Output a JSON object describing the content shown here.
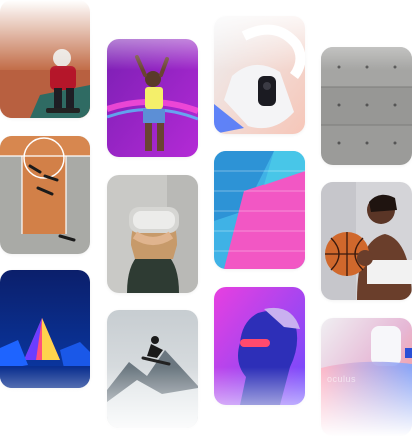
{
  "gallery": {
    "columns": [
      {
        "tiles": [
          {
            "subject": "skateboarder-on-orange-ground-photo"
          },
          {
            "subject": "aerial-basketball-court-players-photo"
          },
          {
            "subject": "neon-pyramid-landscape-photo"
          }
        ]
      },
      {
        "tiles": [
          {
            "subject": "dancer-neon-lights-photo"
          },
          {
            "subject": "vr-headset-user-photo"
          },
          {
            "subject": "snowboarder-mountain-jump-photo"
          }
        ]
      },
      {
        "tiles": [
          {
            "subject": "vr-controller-closeup-photo"
          },
          {
            "subject": "pink-blue-brick-wall-photo"
          },
          {
            "subject": "neon-lit-portrait-photo"
          }
        ]
      },
      {
        "tiles": [
          {
            "subject": "concrete-wall-texture-photo"
          },
          {
            "subject": "basketball-player-portrait-photo"
          },
          {
            "subject": "oculus-headset-gradient-photo",
            "wordmark": "oculus"
          }
        ]
      }
    ]
  },
  "colors": {
    "background": "#ffffff",
    "neon_pink": "#e040c8",
    "neon_blue": "#3a7bff",
    "orange": "#c96a3a"
  }
}
